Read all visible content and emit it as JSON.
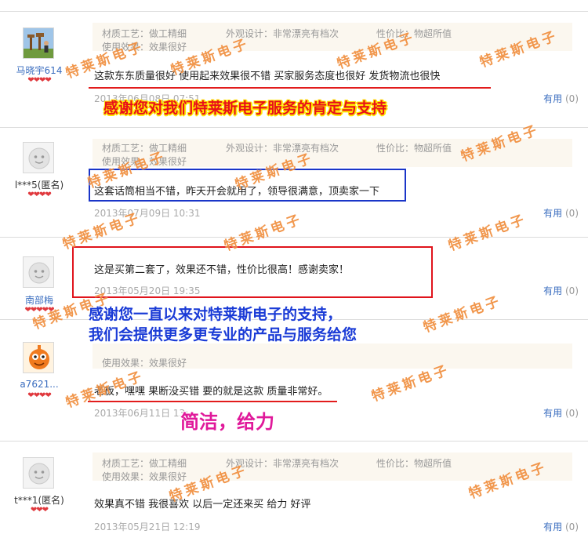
{
  "reviews": [
    {
      "user": "马晓宇614",
      "hearts": "❤❤❤❤",
      "tag_material": "材质工艺：做工精细",
      "tag_look": "外观设计：非常漂亮有档次",
      "tag_value": "性价比：物超所值",
      "tag_effect": "使用效果：效果很好",
      "content": "这款东东质量很好 使用起来效果很不错 买家服务态度也很好 发货物流也很快",
      "date": "2013年06月08日 07:51",
      "useful_label": "有用",
      "useful_count": "(0)"
    },
    {
      "user": "l***5(匿名)",
      "hearts": "❤❤❤❤",
      "tag_material": "材质工艺：做工精细",
      "tag_look": "外观设计：非常漂亮有档次",
      "tag_value": "性价比：物超所值",
      "tag_effect": "使用效果：效果很好",
      "content": "这套话筒相当不错，昨天开会就用了，领导很满意，顶卖家一下",
      "date": "2013年07月09日 10:31",
      "useful_label": "有用",
      "useful_count": "(0)"
    },
    {
      "user": "南部梅",
      "hearts": "❤❤❤❤❤",
      "content": "这是买第二套了，效果还不错，性价比很高！感谢卖家！",
      "date": "2013年05月20日 19:35",
      "useful_label": "有用",
      "useful_count": "(0)"
    },
    {
      "user": "a7621...",
      "hearts": "❤❤❤❤",
      "tag_effect": "使用效果：效果很好",
      "content": "老板，嘿嘿 果断没买错 要的就是这款 质量非常好。",
      "date": "2013年06月11日 13:",
      "useful_label": "有用",
      "useful_count": "(0)"
    },
    {
      "user": "t***1(匿名)",
      "hearts": "❤❤❤",
      "tag_material": "材质工艺：做工精细",
      "tag_look": "外观设计：非常漂亮有档次",
      "tag_value": "性价比：物超所值",
      "tag_effect": "使用效果：效果很好",
      "content": "效果真不错 我很喜欢 以后一定还来买 给力 好评",
      "date": "2013年05月21日 12:19",
      "useful_label": "有用",
      "useful_count": "(0)"
    }
  ],
  "annotations": {
    "thanks_1": "感谢您对我们特莱斯电子服务的肯定与支持",
    "thanks_2a": "感谢您一直以来对特莱斯电子的支持，",
    "thanks_2b": "我们会提供更多更专业的产品与服务给您",
    "slogan": "简洁，给力"
  },
  "watermark": "特莱斯电子",
  "colors": {
    "annotation_red": "#e8101a",
    "annotation_yellow": "#ffe600",
    "annotation_blue": "#1a3bd6",
    "annotation_magenta": "#e0189a",
    "watermark": "#f08c3a",
    "box_blue": "#1a35c8",
    "box_red": "#e0141c",
    "link_blue": "#3a6dbf"
  }
}
